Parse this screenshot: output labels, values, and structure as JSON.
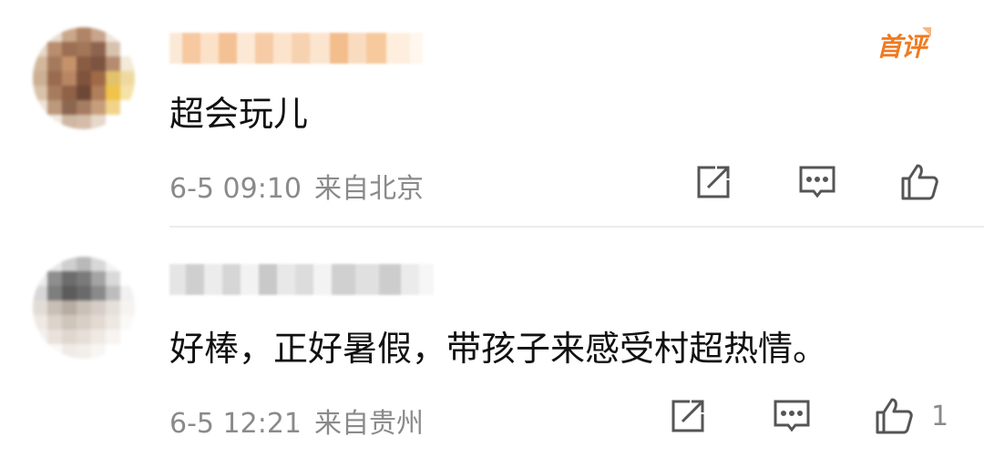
{
  "comments": [
    {
      "badge": "首评",
      "text": "超会玩儿",
      "time": "6-5 09:10",
      "location": "来自北京",
      "likes": ""
    },
    {
      "badge": "",
      "text": "好棒，正好暑假，带孩子来感受村超热情。",
      "time": "6-5 12:21",
      "location": "来自贵州",
      "likes": "1"
    }
  ],
  "icons": {
    "share": "share-icon",
    "reply": "comment-icon",
    "like": "thumbs-up-icon"
  },
  "colors": {
    "badge": "#f07a1e",
    "meta_text": "#8a8a8a",
    "icon_stroke": "#555555",
    "divider": "#ececec"
  }
}
